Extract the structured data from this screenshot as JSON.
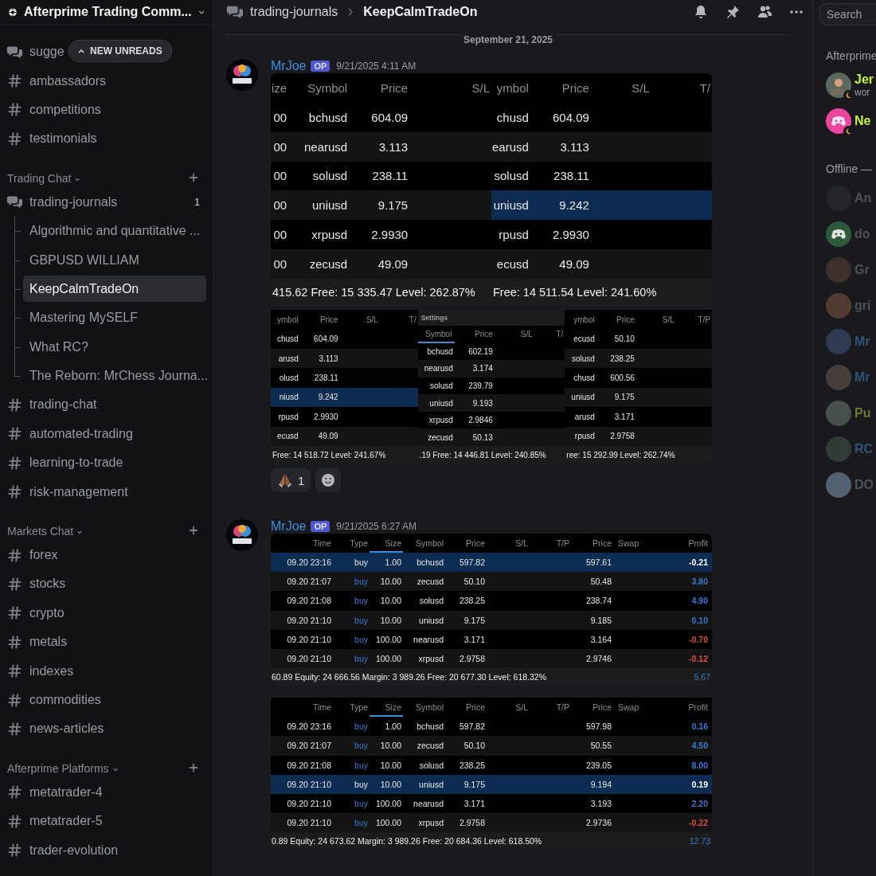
{
  "server": {
    "name": "Afterprime Trading Comm..."
  },
  "new_unreads": {
    "label": "NEW UNREADS"
  },
  "sidebar": {
    "items": [
      {
        "kind": "forum",
        "name": "sugge"
      },
      {
        "kind": "channel",
        "name": "ambassadors"
      },
      {
        "kind": "channel",
        "name": "competitions"
      },
      {
        "kind": "channel",
        "name": "testimonials"
      },
      {
        "kind": "category",
        "name": "Trading Chat"
      },
      {
        "kind": "forum",
        "name": "trading-journals",
        "unread": "1",
        "children": [
          {
            "name": "Algorithmic and quantitative ...",
            "selected": false
          },
          {
            "name": "GBPUSD WILLIAM",
            "selected": false
          },
          {
            "name": "KeepCalmTradeOn",
            "selected": true
          },
          {
            "name": "Mastering MySELF",
            "selected": false
          },
          {
            "name": "What RC?",
            "selected": false
          },
          {
            "name": "The Reborn: MrChess Journa...",
            "selected": false
          }
        ]
      },
      {
        "kind": "channel",
        "name": "trading-chat"
      },
      {
        "kind": "channel",
        "name": "automated-trading"
      },
      {
        "kind": "channel",
        "name": "learning-to-trade"
      },
      {
        "kind": "channel",
        "name": "risk-management"
      },
      {
        "kind": "category",
        "name": "Markets Chat"
      },
      {
        "kind": "channel",
        "name": "forex"
      },
      {
        "kind": "channel",
        "name": "stocks"
      },
      {
        "kind": "channel",
        "name": "crypto"
      },
      {
        "kind": "channel",
        "name": "metals"
      },
      {
        "kind": "channel",
        "name": "indexes"
      },
      {
        "kind": "channel",
        "name": "commodities"
      },
      {
        "kind": "channel",
        "name": "news-articles"
      },
      {
        "kind": "category",
        "name": "Afterprime Platforms"
      },
      {
        "kind": "channel",
        "name": "metatrader-4"
      },
      {
        "kind": "channel",
        "name": "metatrader-5"
      },
      {
        "kind": "channel",
        "name": "trader-evolution"
      }
    ]
  },
  "header": {
    "channel": "trading-journals",
    "thread": "KeepCalmTradeOn",
    "search": {
      "placeholder": "Search"
    }
  },
  "date_divider": "September 21, 2025",
  "messages": [
    {
      "author": "MrJoe",
      "badge": "OP",
      "time": "9/21/2025 4:11 AM",
      "attachment_rows": [
        [
          {
            "kind": "quotes",
            "columns": [
              {
                "label": "ize",
                "sorted": false
              },
              {
                "label": "Symbol",
                "sorted": false
              },
              {
                "label": "Price",
                "sorted": false
              },
              {
                "label": "S/L",
                "sorted": false
              }
            ],
            "rows": [
              {
                "cells": [
                  "00",
                  "bchusd",
                  "604.09"
                ],
                "selected": false
              },
              {
                "cells": [
                  "00",
                  "nearusd",
                  "3.113"
                ],
                "selected": false
              },
              {
                "cells": [
                  "00",
                  "solusd",
                  "238.11"
                ],
                "selected": false
              },
              {
                "cells": [
                  "00",
                  "uniusd",
                  "9.175"
                ],
                "selected": false
              },
              {
                "cells": [
                  "00",
                  "xrpusd",
                  "2.9930"
                ],
                "selected": false
              },
              {
                "cells": [
                  "00",
                  "zecusd",
                  "49.09"
                ],
                "selected": false
              }
            ],
            "footer": "415.62 Free: 15 335.47 Level: 262.87%"
          },
          {
            "kind": "quotes",
            "columns": [
              {
                "label": "ymbol",
                "sorted": false
              },
              {
                "label": "Price",
                "sorted": false
              },
              {
                "label": "S/L",
                "sorted": false
              },
              {
                "label": "T/",
                "sorted": false
              }
            ],
            "rows": [
              {
                "cells": [
                  "chusd",
                  "604.09"
                ],
                "selected": false
              },
              {
                "cells": [
                  "earusd",
                  "3.113"
                ],
                "selected": false
              },
              {
                "cells": [
                  "solusd",
                  "238.11"
                ],
                "selected": false
              },
              {
                "cells": [
                  "uniusd",
                  "9.242"
                ],
                "selected": true
              },
              {
                "cells": [
                  "rpusd",
                  "2.9930"
                ],
                "selected": false
              },
              {
                "cells": [
                  "ecusd",
                  "49.09"
                ],
                "selected": false
              }
            ],
            "footer": "Free: 14 511.54 Level: 241.60%"
          }
        ],
        [
          {
            "kind": "quotes",
            "columns": [
              {
                "label": "ymbol",
                "sorted": false
              },
              {
                "label": "Price",
                "sorted": false
              },
              {
                "label": "S/L",
                "sorted": false
              },
              {
                "label": "T/",
                "sorted": false
              }
            ],
            "rows": [
              {
                "cells": [
                  "chusd",
                  "604.09"
                ],
                "selected": false
              },
              {
                "cells": [
                  "arusd",
                  "3.113"
                ],
                "selected": false
              },
              {
                "cells": [
                  "olusd",
                  "238.11"
                ],
                "selected": false
              },
              {
                "cells": [
                  "niusd",
                  "9.242"
                ],
                "selected": true
              },
              {
                "cells": [
                  "rpusd",
                  "2.9930"
                ],
                "selected": false
              },
              {
                "cells": [
                  "ecusd",
                  "49.09"
                ],
                "selected": false
              }
            ],
            "footer": "Free: 14 518.72 Level: 241.67%"
          },
          {
            "kind": "quotes",
            "title": "Settings",
            "columns": [
              {
                "label": "Symbol",
                "sorted": true
              },
              {
                "label": "Price",
                "sorted": false
              },
              {
                "label": "S/L",
                "sorted": false
              },
              {
                "label": "T/",
                "sorted": false
              }
            ],
            "rows": [
              {
                "cells": [
                  "bchusd",
                  "602.19"
                ],
                "selected": false
              },
              {
                "cells": [
                  "nearusd",
                  "3.174"
                ],
                "selected": false
              },
              {
                "cells": [
                  "solusd",
                  "239.79"
                ],
                "selected": false
              },
              {
                "cells": [
                  "uniusd",
                  "9.193"
                ],
                "selected": false
              },
              {
                "cells": [
                  "xrpusd",
                  "2.9846"
                ],
                "selected": false
              },
              {
                "cells": [
                  "zecusd",
                  "50.13"
                ],
                "selected": false
              }
            ],
            "footer": ".19 Free: 14 446.81 Level: 240.85%"
          },
          {
            "kind": "quotes",
            "columns": [
              {
                "label": "ymbol",
                "sorted": false
              },
              {
                "label": "Price",
                "sorted": false
              },
              {
                "label": "S/L",
                "sorted": false
              },
              {
                "label": "T/P",
                "sorted": false
              }
            ],
            "rows": [
              {
                "cells": [
                  "ecusd",
                  "50.10"
                ],
                "selected": false
              },
              {
                "cells": [
                  "solusd",
                  "238.25"
                ],
                "selected": false
              },
              {
                "cells": [
                  "chusd",
                  "600.56"
                ],
                "selected": false
              },
              {
                "cells": [
                  "uniusd",
                  "9.175"
                ],
                "selected": false
              },
              {
                "cells": [
                  "arusd",
                  "3.171"
                ],
                "selected": false
              },
              {
                "cells": [
                  "rpusd",
                  "2.9758"
                ],
                "selected": false
              }
            ],
            "footer": "ree: 15 292.99 Level: 262.74%"
          }
        ]
      ],
      "reactions": [
        {
          "kind": "praying-hands",
          "count": "1"
        }
      ]
    },
    {
      "author": "MrJoe",
      "badge": "OP",
      "time": "9/21/2025 6:27 AM",
      "attachment_rows": [
        [
          {
            "kind": "positions",
            "columns": [
              {
                "label": "Time",
                "sorted": false
              },
              {
                "label": "Type",
                "sorted": false
              },
              {
                "label": "Size",
                "sorted": true
              },
              {
                "label": "Symbol",
                "sorted": false
              },
              {
                "label": "Price",
                "sorted": false
              },
              {
                "label": "S/L",
                "sorted": false
              },
              {
                "label": "T/P",
                "sorted": false
              },
              {
                "label": "Price",
                "sorted": false
              },
              {
                "label": "Swap",
                "sorted": false
              },
              {
                "label": "Profit",
                "sorted": false
              }
            ],
            "rows": [
              {
                "time": "09.20 23:16",
                "type": "buy",
                "size": "1.00",
                "symbol": "bchusd",
                "price": "597.82",
                "current": "597.61",
                "profit": "-0.21",
                "color": "#ffffff",
                "selected": true
              },
              {
                "time": "09.20 21:07",
                "type": "buy",
                "size": "10.00",
                "symbol": "zecusd",
                "price": "50.10",
                "current": "50.48",
                "profit": "3.80",
                "color": "#3a7bd5",
                "selected": false
              },
              {
                "time": "09.20 21:08",
                "type": "buy",
                "size": "10.00",
                "symbol": "solusd",
                "price": "238.25",
                "current": "238.74",
                "profit": "4.90",
                "color": "#3a7bd5",
                "selected": false
              },
              {
                "time": "09.20 21:10",
                "type": "buy",
                "size": "10.00",
                "symbol": "uniusd",
                "price": "9.175",
                "current": "9.185",
                "profit": "0.10",
                "color": "#3a7bd5",
                "selected": false
              },
              {
                "time": "09.20 21:10",
                "type": "buy",
                "size": "100.00",
                "symbol": "nearusd",
                "price": "3.171",
                "current": "3.164",
                "profit": "-0.70",
                "color": "#d9503c",
                "selected": false
              },
              {
                "time": "09.20 21:10",
                "type": "buy",
                "size": "100.00",
                "symbol": "xrpusd",
                "price": "2.9758",
                "current": "2.9746",
                "profit": "-0.12",
                "color": "#d9503c",
                "selected": false
              }
            ],
            "footer": "60.89 Equity: 24 666.56 Margin: 3 989.26 Free: 20 677.30 Level: 618.32%",
            "total": "5.67"
          }
        ],
        [
          {
            "kind": "positions",
            "columns": [
              {
                "label": "Time",
                "sorted": false
              },
              {
                "label": "Type",
                "sorted": false
              },
              {
                "label": "Size",
                "sorted": true
              },
              {
                "label": "Symbol",
                "sorted": false
              },
              {
                "label": "Price",
                "sorted": false
              },
              {
                "label": "S/L",
                "sorted": false
              },
              {
                "label": "T/P",
                "sorted": false
              },
              {
                "label": "Price",
                "sorted": false
              },
              {
                "label": "Swap",
                "sorted": false
              },
              {
                "label": "Profit",
                "sorted": false
              }
            ],
            "rows": [
              {
                "time": "09.20 23:16",
                "type": "buy",
                "size": "1.00",
                "symbol": "bchusd",
                "price": "597.82",
                "current": "597.98",
                "profit": "0.16",
                "color": "#3a7bd5",
                "selected": false
              },
              {
                "time": "09.20 21:07",
                "type": "buy",
                "size": "10.00",
                "symbol": "zecusd",
                "price": "50.10",
                "current": "50.55",
                "profit": "4.50",
                "color": "#3a7bd5",
                "selected": false
              },
              {
                "time": "09.20 21:08",
                "type": "buy",
                "size": "10.00",
                "symbol": "solusd",
                "price": "238.25",
                "current": "239.05",
                "profit": "8.00",
                "color": "#3a7bd5",
                "selected": false
              },
              {
                "time": "09.20 21:10",
                "type": "buy",
                "size": "10.00",
                "symbol": "uniusd",
                "price": "9.175",
                "current": "9.194",
                "profit": "0.19",
                "color": "#ffffff",
                "selected": true
              },
              {
                "time": "09.20 21:10",
                "type": "buy",
                "size": "100.00",
                "symbol": "nearusd",
                "price": "3.171",
                "current": "3.193",
                "profit": "2.20",
                "color": "#3a7bd5",
                "selected": false
              },
              {
                "time": "09.20 21:10",
                "type": "buy",
                "size": "100.00",
                "symbol": "xrpusd",
                "price": "2.9758",
                "current": "2.9736",
                "profit": "-0.22",
                "color": "#d9503c",
                "selected": false
              }
            ],
            "footer": "0.89 Equity: 24 673.62 Margin: 3 989.26 Free: 20 684.36 Level: 618.50%",
            "total": "12.73"
          }
        ]
      ]
    }
  ],
  "members": {
    "groups": [
      {
        "title": "Afterprime",
        "members": [
          {
            "name": "Jer",
            "subtitle": "wor",
            "color": "#c2f23c",
            "idle": true
          },
          {
            "name": "Ne",
            "color": "#c2f23c",
            "avatar": {
              "kind": "default",
              "color": "#eb459e"
            },
            "idle": true
          }
        ]
      },
      {
        "title": "Offline —",
        "members": [
          {
            "name": "An",
            "color": "#4f5158",
            "idle": false
          },
          {
            "name": "do",
            "color": "#4f5158",
            "avatar": {
              "kind": "default",
              "color": "#2d5a3a"
            },
            "idle": false
          },
          {
            "name": "Gr",
            "color": "#4f5158",
            "idle": false
          },
          {
            "name": "gri",
            "color": "#4f5158",
            "idle": false
          },
          {
            "name": "Mr",
            "color": "#2f5378",
            "idle": false
          },
          {
            "name": "Mr",
            "color": "#2f5378",
            "idle": false
          },
          {
            "name": "Pu",
            "color": "#6d7a2c",
            "idle": false
          },
          {
            "name": "RC",
            "color": "#2f5378",
            "idle": false
          },
          {
            "name": "DO",
            "color": "#4f5158",
            "idle": false
          }
        ]
      }
    ]
  }
}
